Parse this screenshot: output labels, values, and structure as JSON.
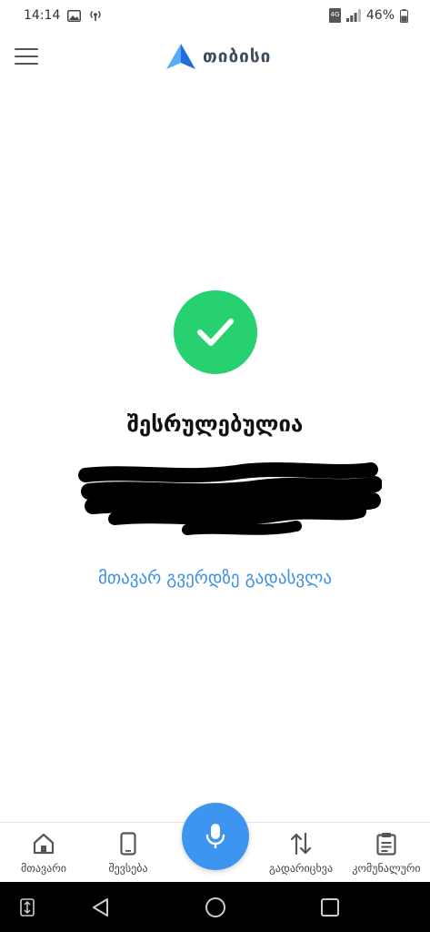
{
  "status_bar": {
    "time": "14:14",
    "battery": "46%",
    "network_label": "4G"
  },
  "app": {
    "brand_name": "თიბისი",
    "brand_color": "#2f8ff0"
  },
  "result": {
    "title": "შესრულებულია",
    "home_link": "მთავარ გვერდზე გადასვლა",
    "success_color": "#27d16f"
  },
  "bottom_nav": {
    "items": [
      {
        "label": "მთავარი",
        "icon": "home-icon"
      },
      {
        "label": "შევსება",
        "icon": "phone-icon"
      },
      {
        "label": "გადარიცხვა",
        "icon": "transfer-icon"
      },
      {
        "label": "კომუნალური",
        "icon": "clipboard-icon"
      }
    ],
    "mic_icon": "microphone-icon",
    "mic_color": "#3d95ef"
  },
  "system_nav": {
    "icons": [
      "accessibility-icon",
      "back-icon",
      "home-circle-icon",
      "recents-icon"
    ]
  }
}
